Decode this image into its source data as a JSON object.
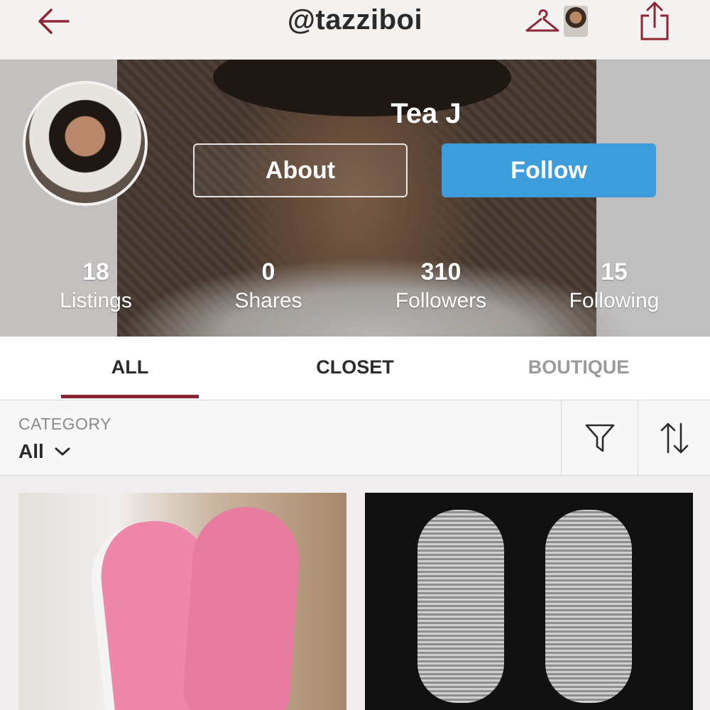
{
  "nav": {
    "username": "@tazziboi",
    "icons": {
      "back": "back-arrow-icon",
      "closet": "hanger-icon",
      "share": "share-icon"
    },
    "accent_color": "#8c2634"
  },
  "profile": {
    "name": "Tea J",
    "about_label": "About",
    "follow_label": "Follow",
    "follow_color": "#3d9ddc",
    "stats": [
      {
        "value": "18",
        "label": "Listings"
      },
      {
        "value": "0",
        "label": "Shares"
      },
      {
        "value": "310",
        "label": "Followers"
      },
      {
        "value": "15",
        "label": "Following"
      }
    ]
  },
  "tabs": [
    {
      "label": "ALL",
      "active": true
    },
    {
      "label": "CLOSET",
      "active": false
    },
    {
      "label": "BOUTIQUE",
      "active": false
    }
  ],
  "filters": {
    "category_label": "CATEGORY",
    "category_value": "All",
    "icons": {
      "filter": "funnel-icon",
      "sort": "sort-arrows-icon",
      "dropdown": "chevron-down-icon"
    }
  },
  "listings": [
    {
      "image": "pink-sneakers"
    },
    {
      "image": "black-sandals"
    }
  ]
}
